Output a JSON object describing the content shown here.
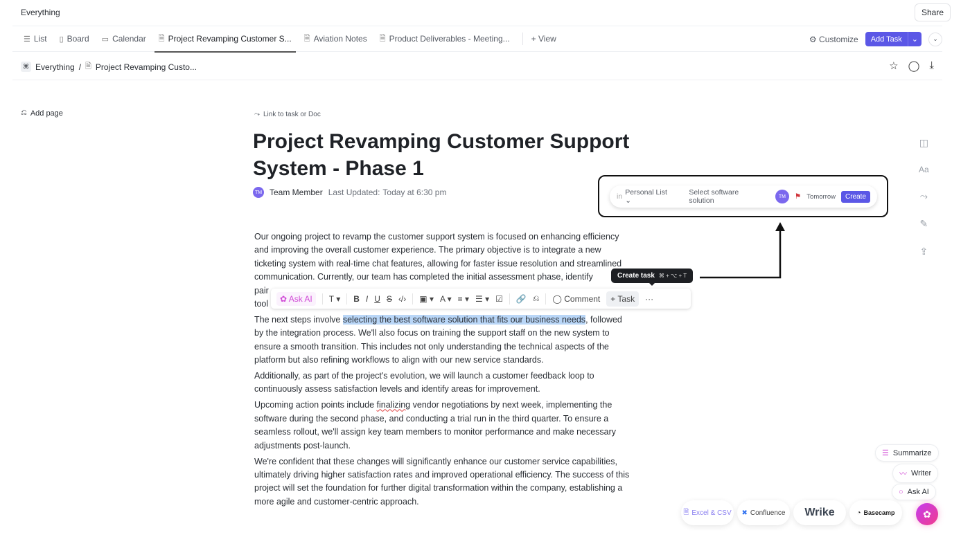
{
  "window": {
    "workspace": "Everything",
    "share": "Share"
  },
  "tabs": [
    {
      "label": "List",
      "icon": "list-icon"
    },
    {
      "label": "Board",
      "icon": "board-icon"
    },
    {
      "label": "Calendar",
      "icon": "calendar-icon"
    },
    {
      "label": "Project Revamping Customer S...",
      "icon": "doc-icon",
      "active": true
    },
    {
      "label": "Aviation Notes",
      "icon": "doc-icon"
    },
    {
      "label": "Product Deliverables - Meeting...",
      "icon": "doc-icon"
    }
  ],
  "add_view": "+ View",
  "toolbar_right": {
    "customize": "Customize",
    "add_task": "Add Task"
  },
  "breadcrumb": {
    "root": "Everything",
    "sep": "/",
    "page": "Project Revamping Custo..."
  },
  "sidebar": {
    "add_page": "Add page"
  },
  "doc": {
    "link": "Link to task or Doc",
    "title": "Project Revamping Customer Support System - Phase 1",
    "author_initials": "TM",
    "author": "Team Member",
    "updated_label": "Last Updated:",
    "updated_value": "Today at 6:30 pm",
    "p1": [
      "Our ongoing project to revamp the customer support system is focused on enhancing efficiency",
      "and improving the overall customer experience. The primary objective is to integrate a new",
      "ticketing system with real-time chat features, allowing for faster issue resolution and streamlined",
      "communication. Currently, our team has completed the initial assessment phase, identify",
      "pair",
      "tool"
    ],
    "p2_pre": "The next steps involve ",
    "p2_hl": "selecting the best software solution that fits our business needs",
    "p2_post": ", followed",
    "p2": [
      "by the integration process. We'll also focus on training the support staff on the new system to",
      "ensure a smooth transition. This includes not only understanding the technical aspects of the",
      "platform but also refining workflows to align with our new service standards."
    ],
    "p3": [
      "Additionally, as part of the project's evolution, we will launch a customer feedback loop to",
      "continuously assess satisfaction levels and identify areas for improvement."
    ],
    "p4_pre": "Upcoming action points include ",
    "p4_err": "finalizing",
    "p4_post": " vendor negotiations by next week, implementing the",
    "p4": [
      "software during the second phase, and conducting a trial run in the third quarter. To ensure a",
      "seamless rollout, we'll assign key team members to monitor performance and make necessary",
      "adjustments post-launch."
    ],
    "p5": [
      "We're confident that these changes will significantly enhance our customer service capabilities,",
      "ultimately driving higher satisfaction rates and improved operational efficiency. The success of this",
      "project will set the foundation for further digital transformation within the company, establishing a",
      "more agile and customer-centric approach."
    ]
  },
  "format_toolbar": {
    "ask_ai": "Ask AI",
    "comment": "Comment",
    "task": "+ Task",
    "more": "···"
  },
  "tooltip": {
    "label": "Create task",
    "shortcut": "⌘ + ⌥ + T"
  },
  "task_popup": {
    "in": "in",
    "list": "Personal List",
    "name": "Select software solution",
    "assignee": "TM",
    "due": "Tomorrow",
    "create": "Create",
    "flag_color": "#d0343a"
  },
  "ai_actions": [
    "Summarize",
    "Writer",
    "Ask AI"
  ],
  "integrations": [
    "Excel & CSV",
    "Confluence",
    "Wrike",
    "Basecamp"
  ],
  "colors": {
    "accent": "#5b57e6",
    "highlight": "#b9d6f7"
  }
}
